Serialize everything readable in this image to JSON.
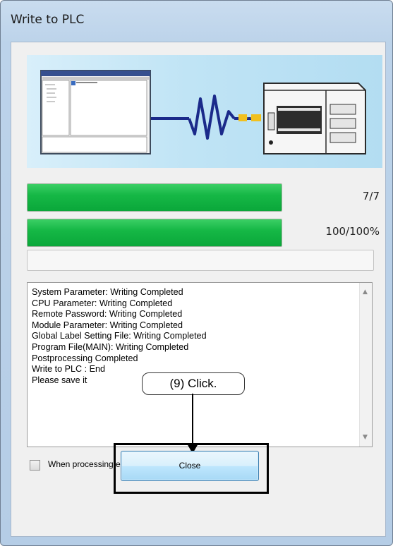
{
  "window": {
    "title": "Write to PLC"
  },
  "progress": [
    {
      "label": "7/7",
      "fraction": 1.0
    },
    {
      "label": "100/100%",
      "fraction": 1.0
    }
  ],
  "log": {
    "lines": [
      "System Parameter: Writing Completed",
      "CPU Parameter: Writing Completed",
      "Remote Password: Writing Completed",
      "Module Parameter: Writing Completed",
      "Global Label Setting File: Writing Completed",
      "Program File(MAIN): Writing Completed",
      "Postprocessing Completed",
      "Write to PLC : End",
      "Please save it"
    ]
  },
  "options": {
    "auto_close_label": "When processing ends, close this window automatically.",
    "auto_close_checked": false
  },
  "buttons": {
    "close_label": "Close"
  },
  "annotation": {
    "callout": "(9) Click."
  },
  "colors": {
    "progress_fill": "#16b846",
    "button_border": "#3c7fb1",
    "window_frame": "#bcd3ea"
  },
  "icons": [
    "software-screen-icon",
    "pc-cable-icon",
    "plc-device-icon",
    "scroll-up-icon",
    "scroll-down-icon"
  ]
}
